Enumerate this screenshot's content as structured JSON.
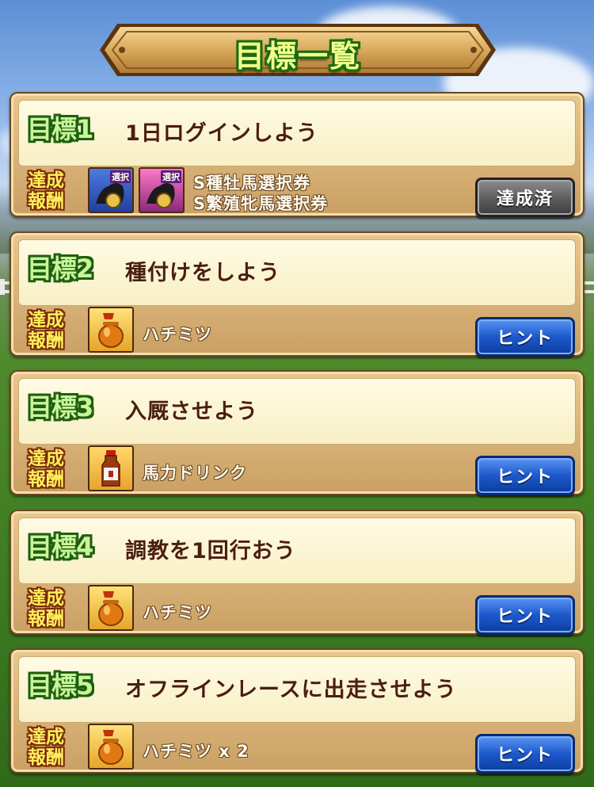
{
  "header": {
    "title": "目標一覧"
  },
  "goals": [
    {
      "label": "目標1",
      "text": "1日ログインしよう",
      "reward_badge": [
        "達成",
        "報酬"
      ],
      "reward_lines": [
        "S種牡馬選択券",
        "S繁殖牝馬選択券"
      ],
      "reward_icons": [
        "ticket-stallion-icon",
        "ticket-broodmare-icon"
      ],
      "icon_tags": [
        "選択",
        "選択"
      ],
      "button_label": "達成済",
      "button_state": "completed"
    },
    {
      "label": "目標2",
      "text": "種付けをしよう",
      "reward_badge": [
        "達成",
        "報酬"
      ],
      "reward_lines": [
        "ハチミツ"
      ],
      "reward_icons": [
        "honey-jar-icon"
      ],
      "button_label": "ヒント",
      "button_state": "hint"
    },
    {
      "label": "目標3",
      "text": "入厩させよう",
      "reward_badge": [
        "達成",
        "報酬"
      ],
      "reward_lines": [
        "馬力ドリンク"
      ],
      "reward_icons": [
        "drink-bottle-icon"
      ],
      "button_label": "ヒント",
      "button_state": "hint"
    },
    {
      "label": "目標4",
      "text": "調教を1回行おう",
      "reward_badge": [
        "達成",
        "報酬"
      ],
      "reward_lines": [
        "ハチミツ"
      ],
      "reward_icons": [
        "honey-jar-icon"
      ],
      "button_label": "ヒント",
      "button_state": "hint"
    },
    {
      "label": "目標5",
      "text": "オフラインレースに出走させよう",
      "reward_badge": [
        "達成",
        "報酬"
      ],
      "reward_lines": [
        "ハチミツ x 2"
      ],
      "reward_icons": [
        "honey-jar-icon"
      ],
      "button_label": "ヒント",
      "button_state": "hint"
    }
  ]
}
